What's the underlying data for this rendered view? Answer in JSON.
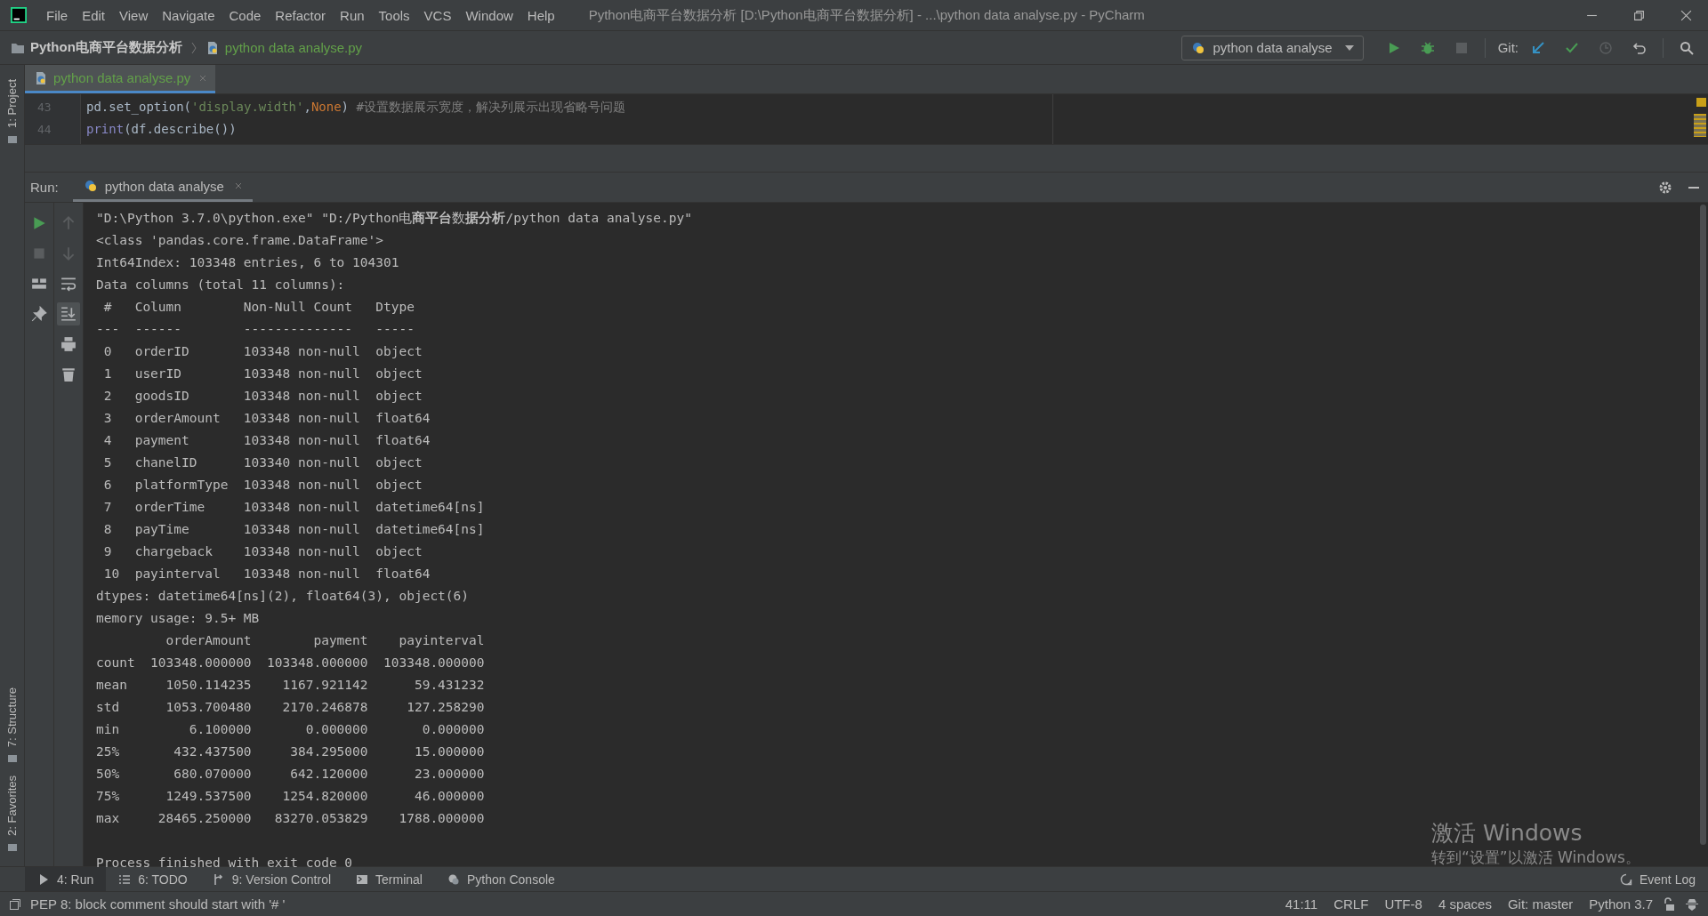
{
  "window": {
    "title": "Python电商平台数据分析 [D:\\Python电商平台数据分析] - ...\\python data analyse.py - PyCharm"
  },
  "menu": [
    "File",
    "Edit",
    "View",
    "Navigate",
    "Code",
    "Refactor",
    "Run",
    "Tools",
    "VCS",
    "Window",
    "Help"
  ],
  "navbar": {
    "project": "Python电商平台数据分析",
    "file": "python data analyse.py",
    "run_config": "python data analyse",
    "git_label": "Git:"
  },
  "side_tools": [
    {
      "label": "1: Project",
      "kind": "top"
    },
    {
      "label": "7: Structure",
      "kind": "bottom"
    },
    {
      "label": "2: Favorites",
      "kind": "bottom"
    }
  ],
  "editor": {
    "tabs": [
      {
        "label": "python data analyse.py",
        "selected": true
      }
    ],
    "lines": [
      {
        "number": "43",
        "tokens": [
          {
            "kind": "code",
            "text": "pd.set_option("
          },
          {
            "kind": "string",
            "text": "'display.width'"
          },
          {
            "kind": "code",
            "text": ","
          },
          {
            "kind": "keyword",
            "text": "None"
          },
          {
            "kind": "code",
            "text": ") "
          },
          {
            "kind": "comment",
            "text": "#设置数据展示宽度，解决列展示出现省略号问题"
          }
        ]
      },
      {
        "number": "44",
        "tokens": [
          {
            "kind": "builtin",
            "text": "print"
          },
          {
            "kind": "code",
            "text": "(df.describe())"
          }
        ]
      }
    ]
  },
  "run": {
    "label": "Run:",
    "tabs": [
      {
        "label": "python data analyse",
        "selected": true
      }
    ],
    "output": [
      "\"D:\\Python 3.7.0\\python.exe\" \"D:/Python电**商平台**数**据分析**/python data analyse.py\"",
      "<class 'pandas.core.frame.DataFrame'>",
      "Int64Index: 103348 entries, 6 to 104301",
      "Data columns (total 11 columns):",
      " #   Column        Non-Null Count   Dtype",
      "---  ------        --------------   -----",
      " 0   orderID       103348 non-null  object",
      " 1   userID        103348 non-null  object",
      " 2   goodsID       103348 non-null  object",
      " 3   orderAmount   103348 non-null  float64",
      " 4   payment       103348 non-null  float64",
      " 5   chanelID      103340 non-null  object",
      " 6   platformType  103348 non-null  object",
      " 7   orderTime     103348 non-null  datetime64[ns]",
      " 8   payTime       103348 non-null  datetime64[ns]",
      " 9   chargeback    103348 non-null  object",
      " 10  payinterval   103348 non-null  float64",
      "dtypes: datetime64[ns](2), float64(3), object(6)",
      "memory usage: 9.5+ MB",
      "         orderAmount        payment    payinterval",
      "count  103348.000000  103348.000000  103348.000000",
      "mean     1050.114235    1167.921142      59.431232",
      "std      1053.700480    2170.246878     127.258290",
      "min         6.100000       0.000000       0.000000",
      "25%       432.437500     384.295000      15.000000",
      "50%       680.070000     642.120000      23.000000",
      "75%      1249.537500    1254.820000      46.000000",
      "max     28465.250000   83270.053829    1788.000000"
    ],
    "exit_message": "Process finished with exit code 0"
  },
  "tool_tabs": [
    {
      "label": "4: Run",
      "selected": true,
      "kind": "run"
    },
    {
      "label": "6: TODO",
      "selected": false,
      "kind": "todo"
    },
    {
      "label": "9: Version Control",
      "selected": false,
      "kind": "vcs"
    },
    {
      "label": "Terminal",
      "selected": false,
      "kind": "terminal"
    },
    {
      "label": "Python Console",
      "selected": false,
      "kind": "python"
    }
  ],
  "event_log": "Event Log",
  "activation": {
    "title": "激活 Windows",
    "subtitle": "转到“设置”以激活 Windows。"
  },
  "status": {
    "message": "PEP 8: block comment should start with '# '",
    "items": [
      "41:11",
      "CRLF",
      "UTF-8",
      "4 spaces",
      "Git: master",
      "Python 3.7"
    ]
  }
}
